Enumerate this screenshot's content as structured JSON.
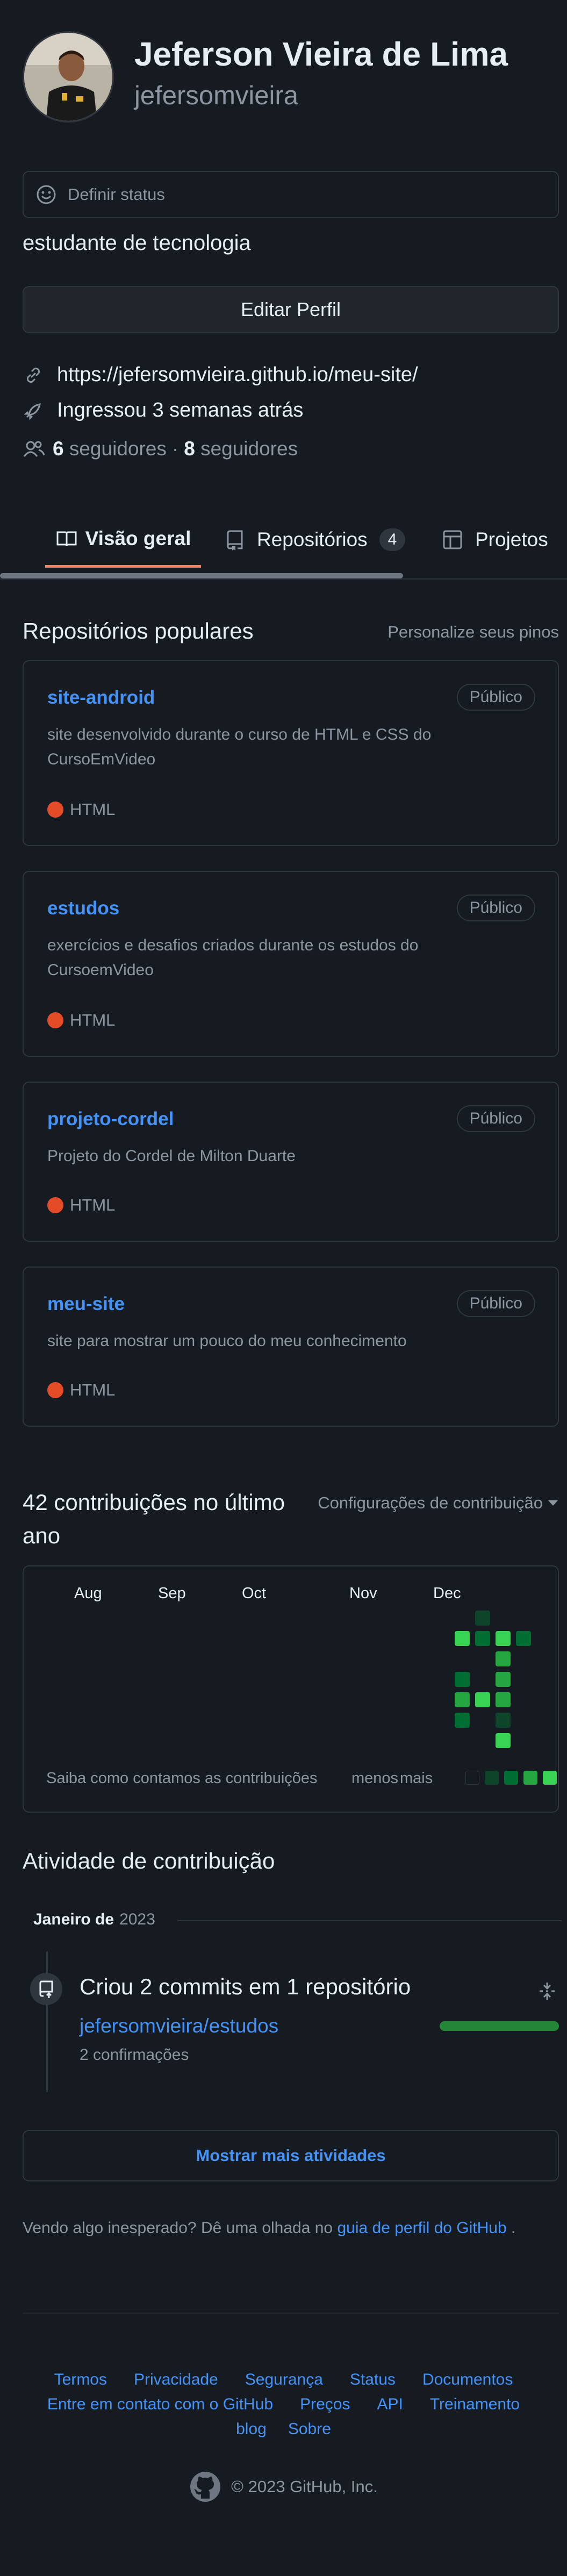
{
  "profile": {
    "name": "Jeferson Vieira de Lima",
    "username": "jefersomvieira",
    "status_placeholder": "Definir status",
    "bio": "estudante de tecnologia",
    "edit_button": "Editar Perfil",
    "website": "https://jefersomvieira.github.io/meu-site/",
    "joined": "Ingressou 3 semanas atrás",
    "followers_count": "6",
    "followers_label": "seguidores",
    "separator": "·",
    "following_count": "8",
    "following_label": "seguidores"
  },
  "tabs": [
    {
      "label": "Visão geral",
      "icon": "book-icon",
      "selected": true
    },
    {
      "label": "Repositórios",
      "icon": "repo-icon",
      "count": "4"
    },
    {
      "label": "Projetos",
      "icon": "table-icon"
    }
  ],
  "popular": {
    "title": "Repositórios populares",
    "customize": "Personalize seus pinos",
    "repos": [
      {
        "name": "site-android",
        "badge": "Público",
        "desc": "site desenvolvido durante o curso de HTML e CSS do CursoEmVideo",
        "lang": "HTML"
      },
      {
        "name": "estudos",
        "badge": "Público",
        "desc": "exercícios e desafios criados durante os estudos do CursoemVideo",
        "lang": "HTML"
      },
      {
        "name": "projeto-cordel",
        "badge": "Público",
        "desc": "Projeto do Cordel de Milton Duarte",
        "lang": "HTML"
      },
      {
        "name": "meu-site",
        "badge": "Público",
        "desc": "site para mostrar um pouco do meu conhecimento",
        "lang": "HTML"
      }
    ]
  },
  "contributions": {
    "title": "42 contribuições no último ano",
    "settings": "Configurações de contribuição",
    "months": [
      "Aug",
      "Sep",
      "Oct",
      "Nov",
      "Dec"
    ],
    "learn": "Saiba como contamos as contribuições",
    "less": "menos",
    "more": "mais",
    "colors": [
      "#161b22",
      "#0e4429",
      "#006d32",
      "#26a641",
      "#39d353"
    ]
  },
  "activity": {
    "title": "Atividade de contribuição",
    "month": "Janeiro de",
    "year": "2023",
    "event_title": "Criou 2 commits em 1 repositório",
    "repo": "jefersomvieira/estudos",
    "commits": "2 confirmações",
    "show_more": "Mostrar mais atividades",
    "unexpected_text": "Vendo algo inesperado? Dê uma olhada no",
    "guide_link": "guia de perfil do GitHub",
    "period": "."
  },
  "footer": {
    "links_row1": [
      "Termos",
      "Privacidade",
      "Segurança",
      "Status",
      "Documentos"
    ],
    "links_row2": [
      "Entre em contato com o GitHub",
      "Preços",
      "API",
      "Treinamento"
    ],
    "links_row3": [
      "blog",
      "Sobre"
    ],
    "copyright": "© 2023 GitHub, Inc."
  }
}
